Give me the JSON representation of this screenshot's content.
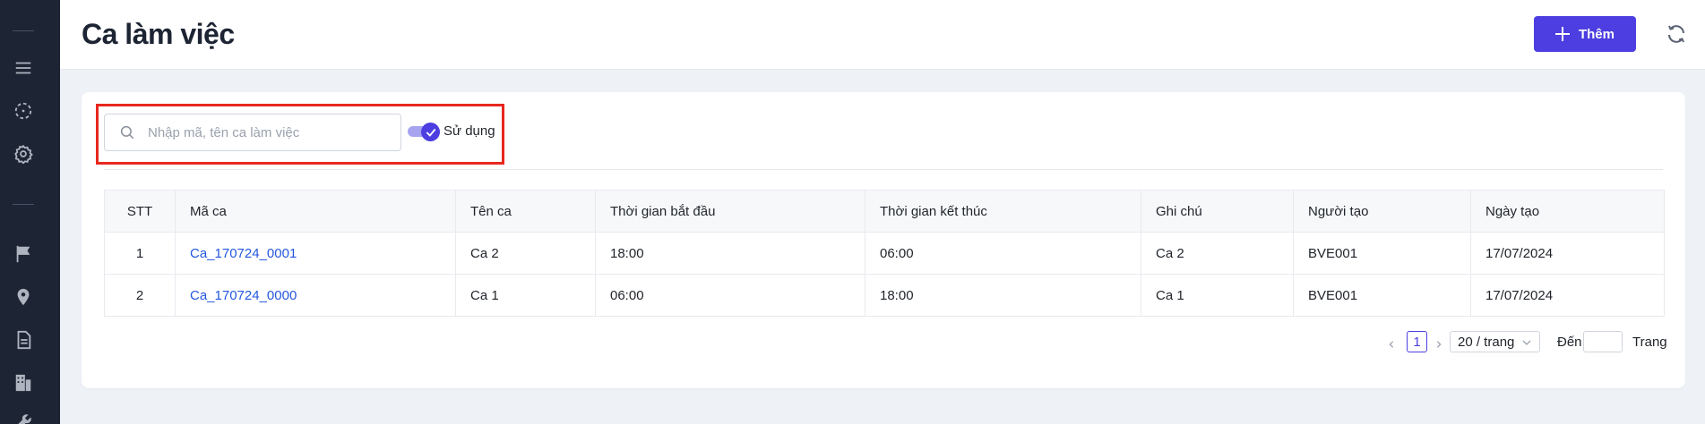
{
  "header": {
    "title": "Ca làm việc",
    "add_label": "Thêm"
  },
  "filters": {
    "search_placeholder": "Nhập mã, tên ca làm việc",
    "search_value": "",
    "toggle_label": "Sử dụng",
    "toggle_on": true
  },
  "table": {
    "columns": [
      "STT",
      "Mã ca",
      "Tên ca",
      "Thời gian bắt đầu",
      "Thời gian kết thúc",
      "Ghi chú",
      "Người tạo",
      "Ngày tạo"
    ],
    "rows": [
      {
        "stt": "1",
        "code": "Ca_170724_0001",
        "name": "Ca 2",
        "start": "18:00",
        "end": "06:00",
        "note": "Ca 2",
        "creator": "BVE001",
        "created": "17/07/2024"
      },
      {
        "stt": "2",
        "code": "Ca_170724_0000",
        "name": "Ca 1",
        "start": "06:00",
        "end": "18:00",
        "note": "Ca 1",
        "creator": "BVE001",
        "created": "17/07/2024"
      }
    ]
  },
  "pagination": {
    "current_page": "1",
    "page_size": "20 / trang",
    "goto_label": "Đến",
    "goto_suffix": "Trang"
  },
  "colors": {
    "primary": "#4c3ee0",
    "sidebar": "#1d2433",
    "link": "#2457e0",
    "highlight": "#e8281e"
  },
  "icons": {
    "sidebar": [
      "menu-icon",
      "dashed-circle-icon",
      "gear-icon",
      "flag-icon",
      "location-pin-icon",
      "document-icon",
      "building-icon",
      "wrench-icon"
    ],
    "header": [
      "plus-icon",
      "refresh-icon"
    ]
  }
}
